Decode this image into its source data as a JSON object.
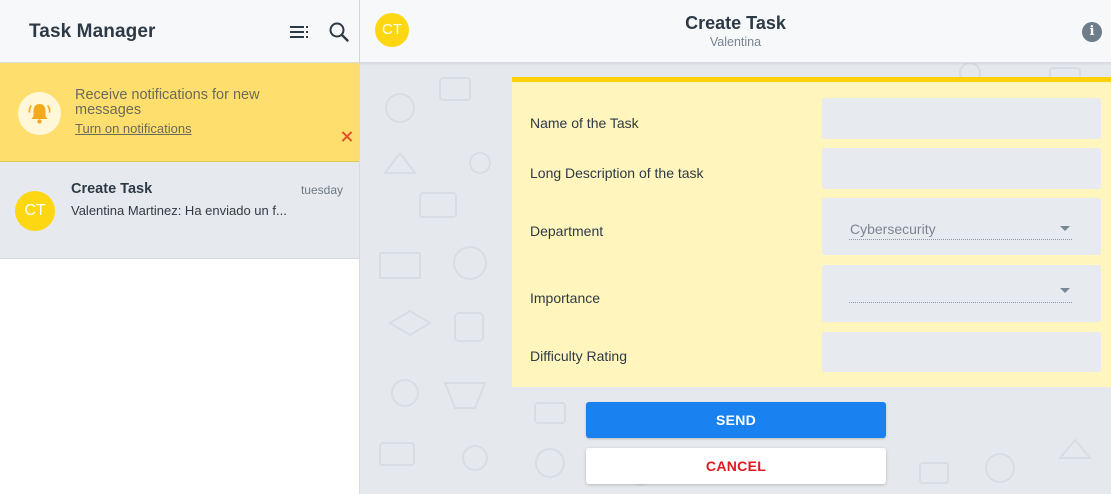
{
  "sidebar": {
    "title": "Task Manager",
    "menu_icon": "list-menu-icon",
    "search_icon": "search-icon",
    "notification": {
      "text": "Receive notifications for new messages",
      "link": "Turn on notifications",
      "icon": "bell-icon",
      "close_icon": "close-icon",
      "close_color": "#e0502c",
      "background": "#fedf6d"
    },
    "chats": [
      {
        "avatar": "CT",
        "name": "Create Task",
        "time": "tuesday",
        "preview": "Valentina Martinez: Ha enviado un f..."
      }
    ]
  },
  "chat": {
    "avatar": "CT",
    "title": "Create Task",
    "subtitle": "Valentina",
    "info_icon": "info-icon",
    "avatar_color": "#fdd711"
  },
  "form": {
    "fields": [
      {
        "label": "Name of the Task",
        "value": ""
      },
      {
        "label": "Long Description of the task",
        "value": ""
      },
      {
        "label": "Department",
        "value": "Cybersecurity"
      },
      {
        "label": "Importance",
        "value": ""
      },
      {
        "label": "Difficulty Rating",
        "value": ""
      }
    ],
    "send_label": "SEND",
    "cancel_label": "CANCEL",
    "send_color": "#1a82f0",
    "cancel_color": "#e0191e",
    "card_color": "#fff5bd",
    "card_border_color": "#fdd20a"
  }
}
